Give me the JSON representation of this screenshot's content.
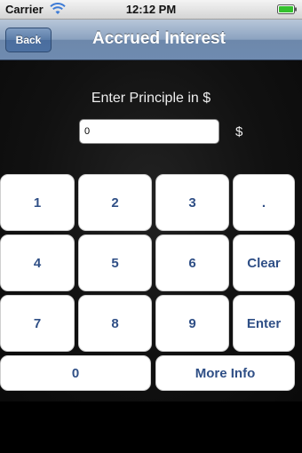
{
  "status_bar": {
    "carrier": "Carrier",
    "time": "12:12 PM",
    "battery_color": "#35c12e"
  },
  "nav_bar": {
    "back_label": "Back",
    "title": "Accrued Interest"
  },
  "form": {
    "prompt": "Enter Principle in $",
    "input_value": "0",
    "currency_symbol": "$"
  },
  "keypad": {
    "keys": [
      "1",
      "2",
      "3",
      ".",
      "4",
      "5",
      "6",
      "Clear",
      "7",
      "8",
      "9",
      "Enter"
    ],
    "zero": "0",
    "more_info": "More Info"
  },
  "colors": {
    "key_text": "#2f4f86",
    "nav_bar": "#6f8bb0"
  }
}
